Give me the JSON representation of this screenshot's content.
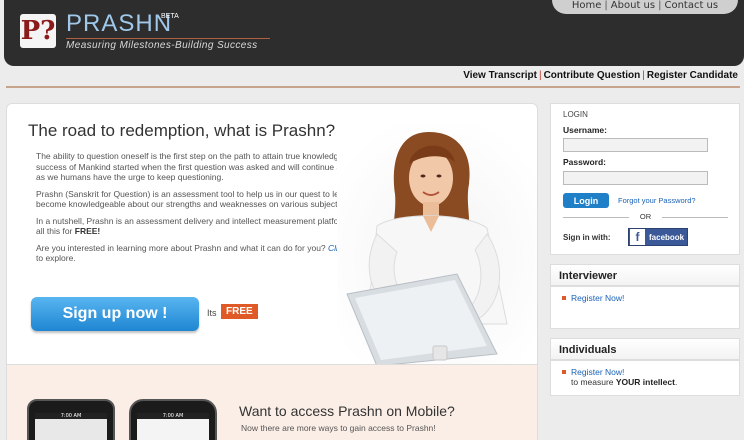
{
  "header": {
    "logo_glyph": "P?",
    "brand": "PRASHN",
    "beta": "BETA",
    "tagline": "Measuring Milestones-Building Success",
    "top_links": [
      "Home",
      "About us",
      "Contact us"
    ]
  },
  "nav": {
    "links": [
      "View Transcript",
      "Contribute Question",
      "Register Candidate"
    ]
  },
  "main": {
    "title": "The road to redemption, what is Prashn?",
    "p1": "The ability to question oneself is the first step on the path to attain true knowledge. The success of Mankind started when the first question was asked and will continue as long as we humans have the urge to keep questioning.",
    "p2": "Prashn (Sanskrit for Question) is an assessment tool to help us in our quest to learn and become knowledgeable about our strengths and weaknesses on various subjects.",
    "p3_text": "In a nutshell, Prashn is an assessment delivery and intellect measurement platform, and all this for ",
    "p3_bold": "FREE!",
    "p4_text": "Are you interested in learning more about Prashn and what it can do for you?",
    "p4_link": "Click here",
    "p4_tail": "to explore.",
    "signup_label": "Sign up now !",
    "its_label": "Its",
    "free_badge": "FREE"
  },
  "mobile": {
    "title": "Want to access Prashn on Mobile?",
    "subtitle": "Now there are more ways to gain access to Prashn!",
    "phone_time": "7:00 AM"
  },
  "login": {
    "title": "LOGIN",
    "username_label": "Username:",
    "password_label": "Password:",
    "button": "Login",
    "forgot": "Forgot your Password?",
    "or": "OR",
    "signin_with": "Sign in with:",
    "facebook_glyph": "f",
    "facebook": "facebook"
  },
  "interviewer": {
    "title": "Interviewer",
    "link": "Register Now!"
  },
  "individuals": {
    "title": "Individuals",
    "link": "Register Now!",
    "extra_text": "to measure ",
    "extra_bold": "YOUR intellect",
    "extra_tail": "."
  },
  "colors": {
    "header_bg": "#2d2d2d",
    "brand": "#9fc8ea",
    "accent": "#e05a27",
    "signup": "#1f86d2",
    "facebook": "#3b5998"
  }
}
